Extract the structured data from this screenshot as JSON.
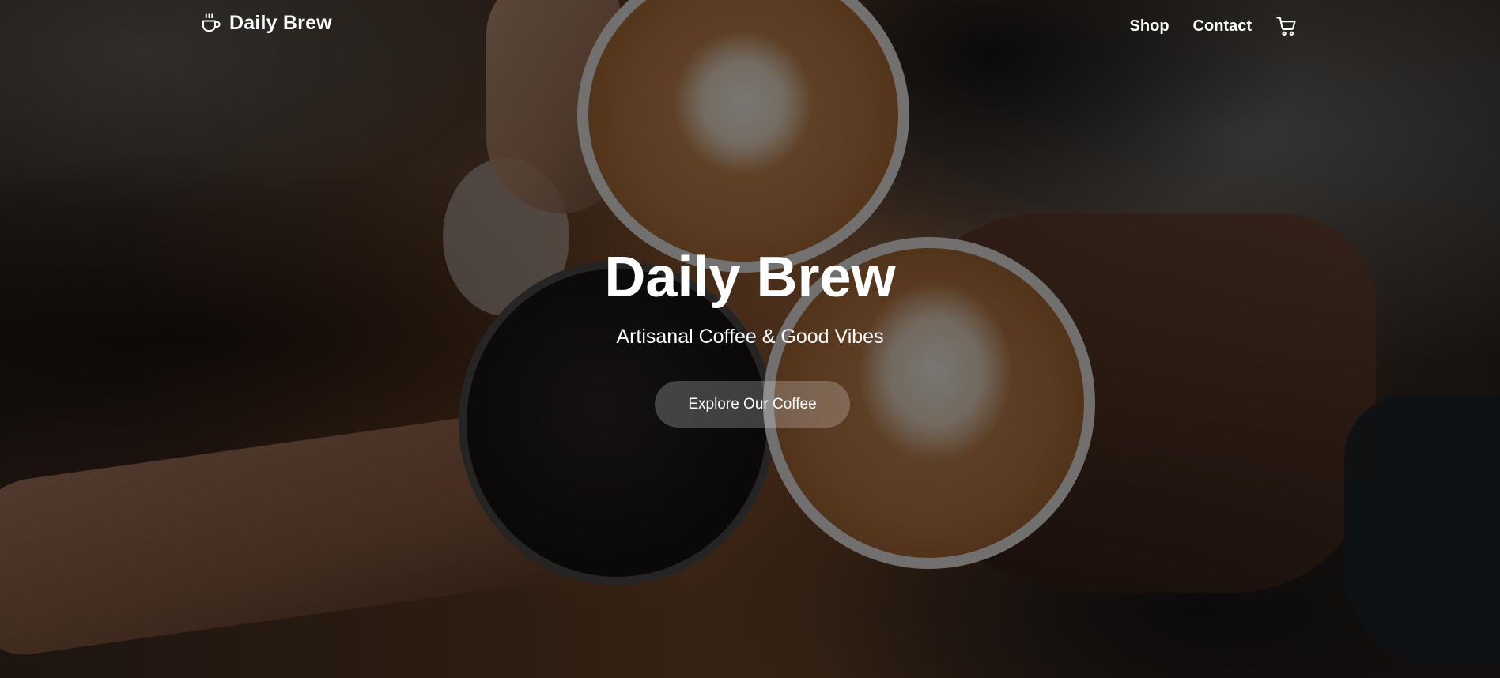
{
  "header": {
    "brand_name": "Daily Brew",
    "brand_icon": "coffee-cup-icon",
    "nav": [
      {
        "label": "Shop"
      },
      {
        "label": "Contact"
      }
    ],
    "cart_icon": "shopping-cart-icon"
  },
  "hero": {
    "title": "Daily Brew",
    "subtitle": "Artisanal Coffee & Good Vibes",
    "cta_label": "Explore Our Coffee",
    "background": "photo-coffee-cups-cheers"
  },
  "colors": {
    "text": "#ffffff",
    "overlay": "#000000",
    "cta_bg": "#ffffff"
  }
}
